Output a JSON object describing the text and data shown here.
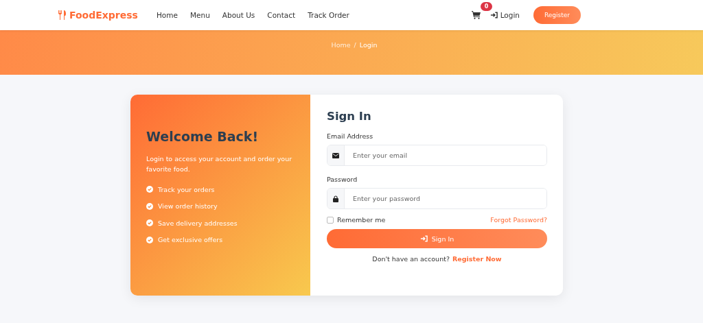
{
  "header": {
    "brand": "FoodExpress",
    "nav": [
      {
        "label": "Home",
        "selected": false
      },
      {
        "label": "Menu",
        "selected": false
      },
      {
        "label": "About Us",
        "selected": false
      },
      {
        "label": "Contact",
        "selected": false
      },
      {
        "label": "Track Order",
        "selected": false
      }
    ],
    "cart_count": "0",
    "login": "Login",
    "register": "Register"
  },
  "breadcrumb": {
    "items": [
      "Home",
      "Login"
    ],
    "separator": "/"
  },
  "welcome": {
    "title": "Welcome Back!",
    "text": "Login to access your account and order your favorite food.",
    "features": [
      "Track your orders",
      "View order history",
      "Save delivery addresses",
      "Get exclusive offers"
    ]
  },
  "form": {
    "title": "Sign In",
    "fields": [
      {
        "kind": "email",
        "label": "Email Address",
        "placeholder": "Enter your email"
      },
      {
        "kind": "password",
        "label": "Password",
        "placeholder": "Enter your password"
      }
    ],
    "remember": {
      "label": "Remember me",
      "checked": false
    },
    "forgot": "Forgot Password?",
    "submit": "Sign In",
    "footer_text": "Don't have an account?",
    "footer_link": "Register Now"
  }
}
